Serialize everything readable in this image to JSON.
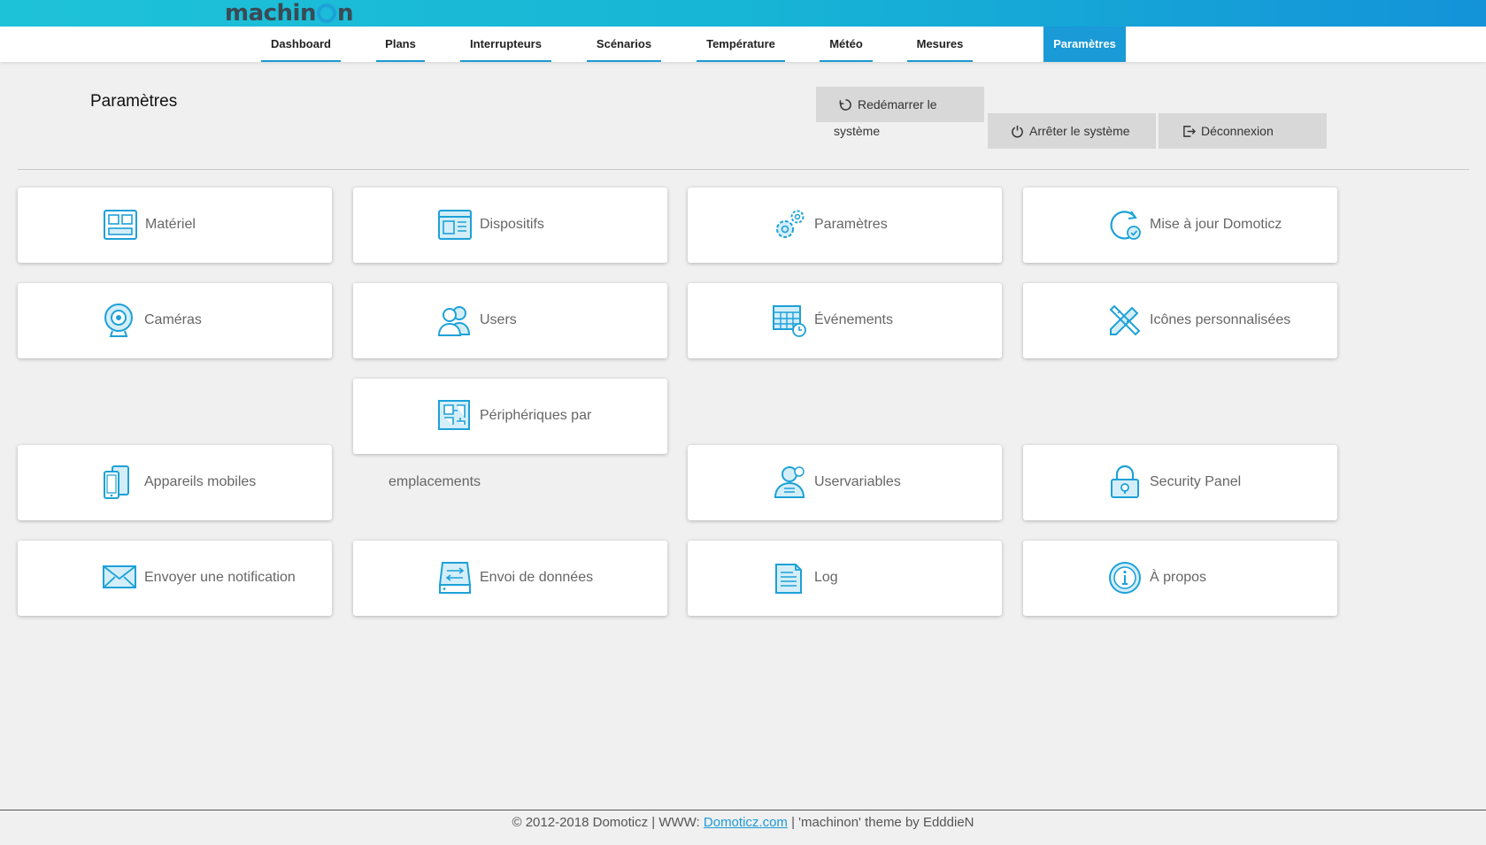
{
  "header": {
    "logo_left": "machin",
    "logo_right": "n"
  },
  "nav": {
    "items": [
      {
        "label": "Dashboard"
      },
      {
        "label": "Plans"
      },
      {
        "label": "Interrupteurs"
      },
      {
        "label": "Scénarios"
      },
      {
        "label": "Température"
      },
      {
        "label": "Météo"
      },
      {
        "label": "Mesures"
      },
      {
        "label": "Paramètres"
      }
    ],
    "active": "Paramètres"
  },
  "page": {
    "title": "Paramètres",
    "restart_label": "Redémarrer le",
    "restart_label_wrap": "système",
    "shutdown_label": "Arrêter le système",
    "logout_label": "Déconnexion"
  },
  "tiles": [
    {
      "label": "Matériel",
      "icon": "hardware-icon"
    },
    {
      "label": "Dispositifs",
      "icon": "devices-icon"
    },
    {
      "label": "Paramètres",
      "icon": "settings-gears-icon"
    },
    {
      "label": "Mise à jour Domoticz",
      "icon": "update-icon"
    },
    {
      "label": "Caméras",
      "icon": "camera-icon"
    },
    {
      "label": "Users",
      "icon": "users-icon"
    },
    {
      "label": "Événements",
      "icon": "events-icon"
    },
    {
      "label": "Icônes personnalisées",
      "icon": "custom-icons-icon"
    },
    {
      "label": "Appareils mobiles",
      "icon": "mobile-devices-icon"
    },
    {
      "label": "Périphériques par",
      "label_wrap": "emplacements",
      "icon": "room-plan-icon"
    },
    {
      "label": "Uservariables",
      "icon": "user-variables-icon"
    },
    {
      "label": "Security Panel",
      "icon": "security-lock-icon"
    },
    {
      "label": "Envoyer une notification",
      "icon": "envelope-icon"
    },
    {
      "label": "Envoi de données",
      "icon": "data-push-icon"
    },
    {
      "label": "Log",
      "icon": "log-icon"
    },
    {
      "label": "À propos",
      "icon": "info-icon"
    }
  ],
  "footer": {
    "prefix": "© 2012-2018 Domoticz | WWW: ",
    "link": "Domoticz.com",
    "suffix": " | 'machinon' theme by EdddieN"
  },
  "colors": {
    "accent": "#1a9ad6",
    "icon": "#1da1d8",
    "background": "#f0f0f0"
  }
}
